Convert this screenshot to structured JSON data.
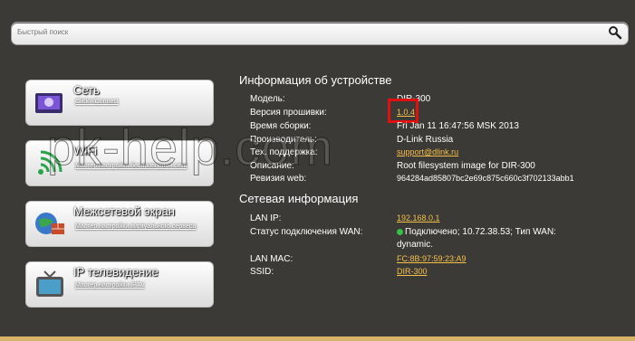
{
  "search": {
    "placeholder": "Быстрый поиск"
  },
  "menu": [
    {
      "title": "Сеть",
      "link": "Click'n'Connect"
    },
    {
      "title": "WiFi",
      "link": "Мастер настройки беспроводной сети"
    },
    {
      "title": "Межсетевой экран",
      "link": "Мастер настройки виртуального сервера"
    },
    {
      "title": "IP телевидение",
      "link": "Мастер настройки IPTV"
    }
  ],
  "device_info": {
    "heading": "Информация об устройстве",
    "rows": [
      {
        "label": "Модель:",
        "value": "DIR-300"
      },
      {
        "label": "Версия прошивки:",
        "value": "1.0.4"
      },
      {
        "label": "Время сборки:",
        "value": "Fri Jan 11 16:47:56 MSK 2013"
      },
      {
        "label": "Производитель:",
        "value": "D-Link Russia"
      },
      {
        "label": "Тех. поддержка:",
        "value": "support@dlink.ru"
      },
      {
        "label": "Описание:",
        "value": "Root filesystem image for DIR-300"
      },
      {
        "label": "Ревизия web:",
        "value": "964284ad85807bc2e69c875c660c3f702133abb1"
      }
    ]
  },
  "network_info": {
    "heading": "Сетевая информация",
    "rows": [
      {
        "label": "LAN IP:",
        "value": "192.168.0.1"
      },
      {
        "label": "Статус подключения WAN:",
        "value": "Подключено; 10.72.38.53; Тип WAN:",
        "value2": "dynamic."
      },
      {
        "label": "LAN MAC:",
        "value": "FC:8B:97:59:23:A9"
      },
      {
        "label": "SSID:",
        "value": "DIR-300"
      }
    ]
  },
  "watermark": "pk-help.com",
  "colors": {
    "link": "#f5c04a",
    "highlight_box": "#e01010",
    "status_ok": "#35c046",
    "bg": "#3b3a37"
  }
}
